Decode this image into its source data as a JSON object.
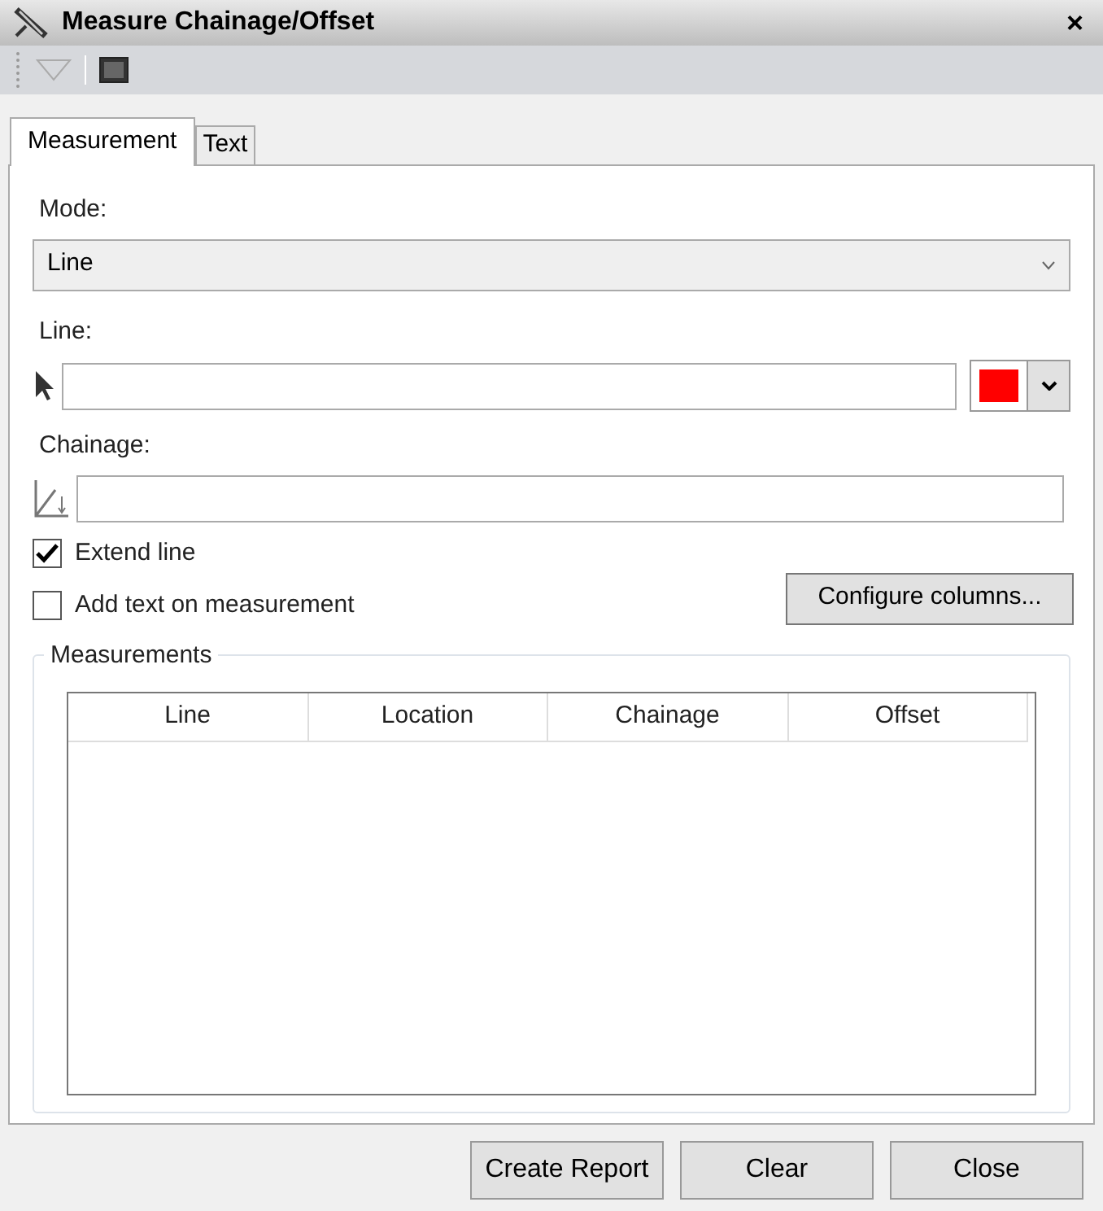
{
  "window": {
    "title": "Measure Chainage/Offset",
    "close": "×"
  },
  "tabs": [
    {
      "label": "Measurement",
      "selected": true
    },
    {
      "label": "Text",
      "selected": false
    }
  ],
  "mode": {
    "label": "Mode:",
    "value": "Line"
  },
  "line": {
    "label": "Line:",
    "color": "#ff0000"
  },
  "chainage": {
    "label": "Chainage:"
  },
  "checkboxes": [
    {
      "label": "Extend line",
      "checked": true
    },
    {
      "label": "Add text on measurement",
      "checked": false
    }
  ],
  "configure_button": "Configure columns...",
  "measurements": {
    "title": "Measurements",
    "columns": [
      "Line",
      "Location",
      "Chainage",
      "Offset"
    ]
  },
  "buttons": [
    "Create Report",
    "Clear",
    "Close"
  ]
}
